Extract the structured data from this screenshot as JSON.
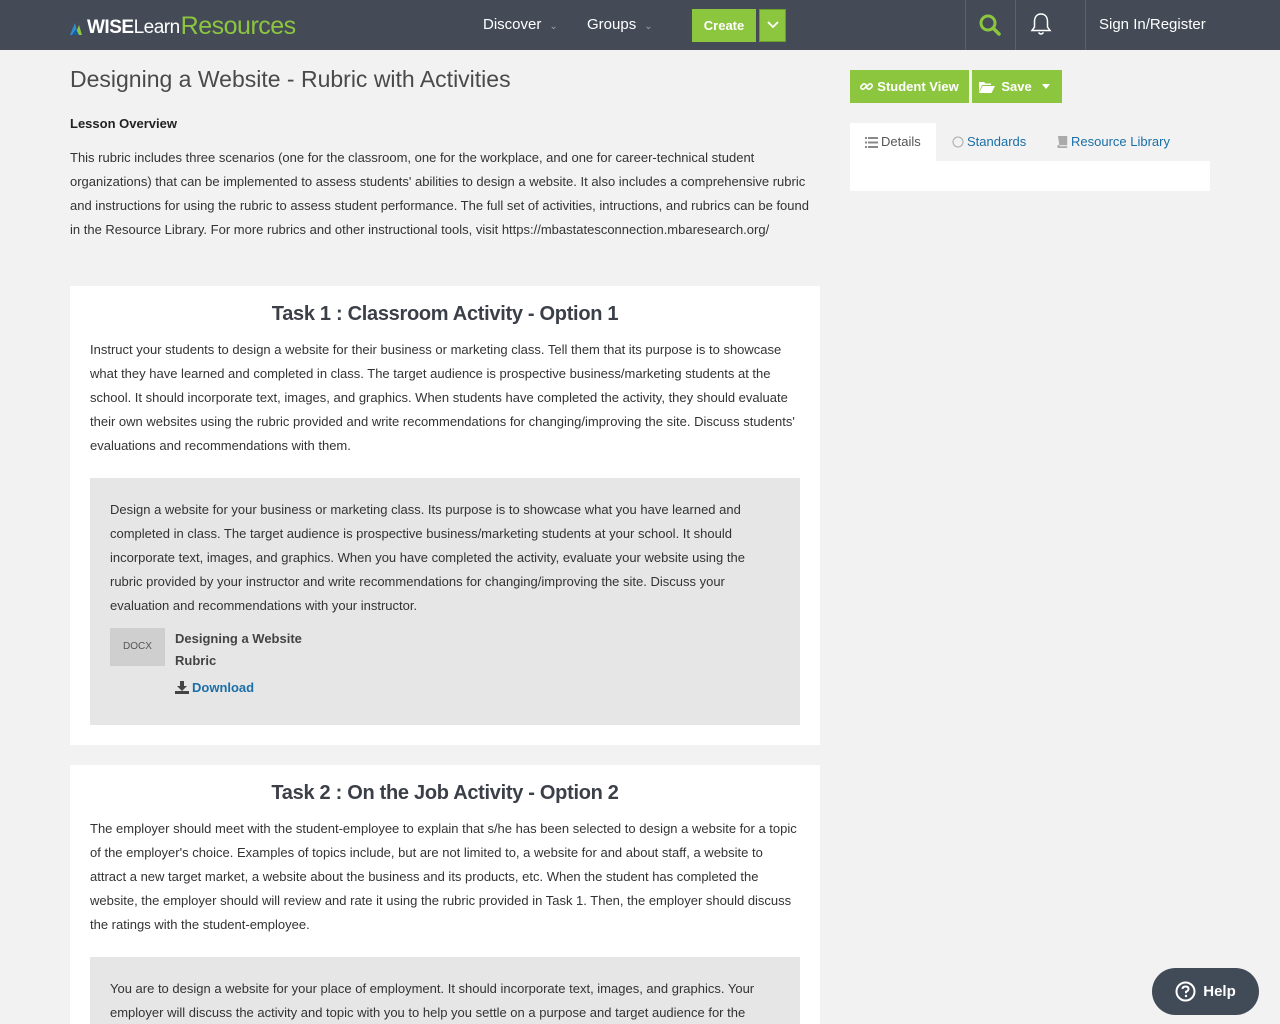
{
  "header": {
    "logo": {
      "wise": "WISE",
      "learn": "Learn",
      "resources": "Resources"
    },
    "nav": [
      {
        "label": "Discover"
      },
      {
        "label": "Groups"
      }
    ],
    "create_label": "Create",
    "signin_label": "Sign In/Register"
  },
  "lesson": {
    "title": "Designing a Website - Rubric with Activities",
    "overview_heading": "Lesson Overview",
    "overview_text": "This rubric includes three scenarios (one for the classroom, one for the workplace, and one for career-technical student organizations) that can be implemented to assess students' abilities to design a website. It also includes a comprehensive rubric and instructions for using the rubric to assess student performance. The full set of activities, intructions, and rubrics can be found in the Resource Library. For more rubrics and other instructional tools, visit https://mbastatesconnection.mbaresearch.org/"
  },
  "tasks": [
    {
      "title": "Task 1 : Classroom Activity - Option 1",
      "teacher_text": "Instruct your students to design a website for their business or marketing class. Tell them that its purpose is to showcase what they have learned and completed in class. The target audience is prospective business/marketing students at the school. It should incorporate text, images, and graphics. When students have completed the activity, they should evaluate their own websites using the rubric provided and write recommendations for changing/improving the site. Discuss students' evaluations and recommendations with them.",
      "student_text": "Design a website for your business or marketing class. Its purpose is to showcase what you have learned and completed in class. The target audience is prospective business/marketing students at your school. It should incorporate text, images, and graphics. When you have completed the activity, evaluate your website using the rubric provided by your instructor and write recommendations for changing/improving the site. Discuss your evaluation and recommendations with your instructor.",
      "attachment": {
        "type": "DOCX",
        "name": "Designing a Website Rubric",
        "download_label": "Download"
      }
    },
    {
      "title": "Task 2 : On the Job Activity - Option 2",
      "teacher_text": "The employer should meet with the student-employee to explain that s/he has been selected to design a website for a topic of the employer's choice. Examples of topics include, but are not limited to, a website for and about staff, a website to attract a new target market, a website about the business and its products, etc. When the student has completed the website, the employer should will review and rate it using the rubric provided in Task 1. Then, the employer should discuss the ratings with the student-employee.",
      "student_text": "You are to design a website for your place of employment. It should incorporate text, images, and graphics. Your employer will discuss the activity and topic with you to help you settle on a purpose and target audience for the"
    }
  ],
  "sidebar": {
    "student_view_label": "Student View",
    "save_label": "Save",
    "tabs": [
      {
        "label": "Details"
      },
      {
        "label": "Standards"
      },
      {
        "label": "Resource Library"
      }
    ]
  },
  "help_label": "Help",
  "colors": {
    "header_bg": "#444b57",
    "accent_green": "#8cc63f",
    "link_blue": "#1a6fa8",
    "page_bg": "#f2f2f2"
  }
}
